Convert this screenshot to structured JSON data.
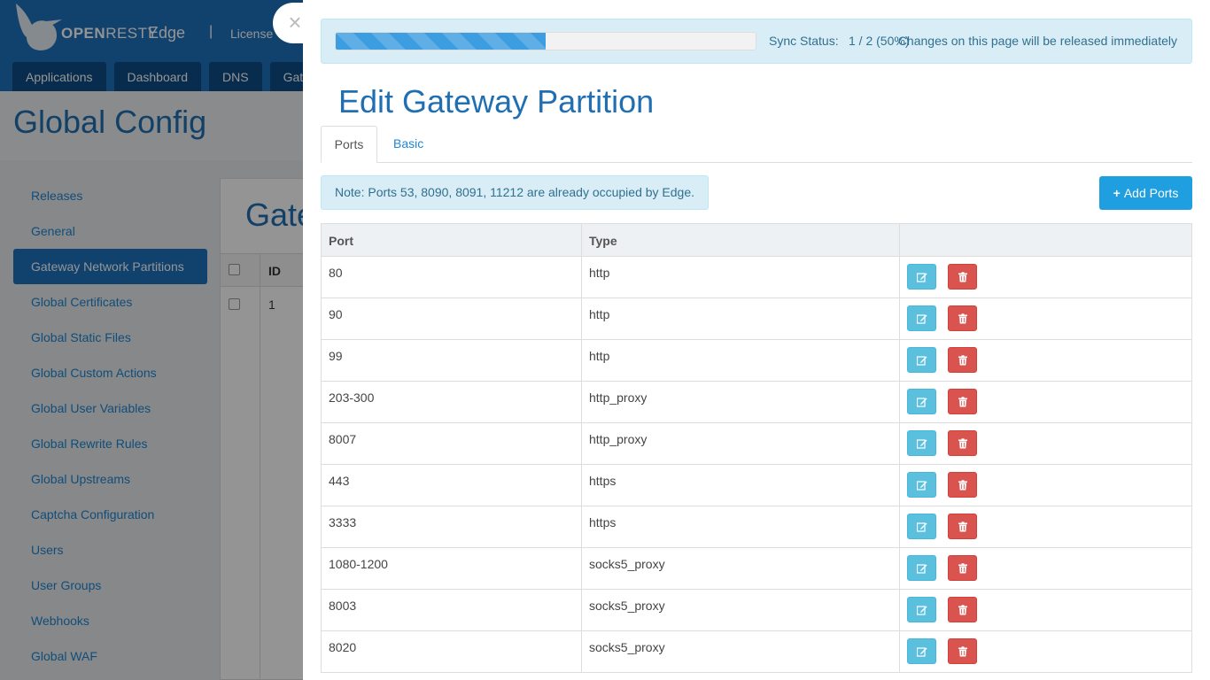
{
  "app": {
    "brand_open": "OPEN",
    "brand_resty": "RESTY",
    "product": "Edge",
    "separator": "|",
    "license_label": "License"
  },
  "nav_tabs": [
    "Applications",
    "Dashboard",
    "DNS",
    "Gat"
  ],
  "page_title": "Global Config",
  "sidebar": {
    "items": [
      {
        "label": "Releases",
        "active": false
      },
      {
        "label": "General",
        "active": false
      },
      {
        "label": "Gateway Network Partitions",
        "active": true
      },
      {
        "label": "Global Certificates",
        "active": false
      },
      {
        "label": "Global Static Files",
        "active": false
      },
      {
        "label": "Global Custom Actions",
        "active": false
      },
      {
        "label": "Global User Variables",
        "active": false
      },
      {
        "label": "Global Rewrite Rules",
        "active": false
      },
      {
        "label": "Global Upstreams",
        "active": false
      },
      {
        "label": "Captcha Configuration",
        "active": false
      },
      {
        "label": "Users",
        "active": false
      },
      {
        "label": "User Groups",
        "active": false
      },
      {
        "label": "Webhooks",
        "active": false
      },
      {
        "label": "Global WAF",
        "active": false
      }
    ]
  },
  "background_panel": {
    "title": "Gate",
    "id_header": "ID",
    "first_id": "1"
  },
  "drawer": {
    "close_glyph": "×",
    "sync": {
      "label": "Sync Status:",
      "value": "1 / 2 (50%)",
      "progress": 0.5,
      "note": "Changes on this page will be released immediately"
    },
    "title": "Edit Gateway Partition",
    "tabs": [
      {
        "label": "Ports",
        "active": true
      },
      {
        "label": "Basic",
        "active": false
      }
    ],
    "note": "Note: Ports 53, 8090, 8091, 11212 are already occupied by Edge.",
    "add_button": "Add Ports",
    "add_icon": "+",
    "table": {
      "columns": [
        "Port",
        "Type",
        ""
      ],
      "rows": [
        {
          "port": "80",
          "type": "http"
        },
        {
          "port": "90",
          "type": "http"
        },
        {
          "port": "99",
          "type": "http"
        },
        {
          "port": "203-300",
          "type": "http_proxy"
        },
        {
          "port": "8007",
          "type": "http_proxy"
        },
        {
          "port": "443",
          "type": "https"
        },
        {
          "port": "3333",
          "type": "https"
        },
        {
          "port": "1080-1200",
          "type": "socks5_proxy"
        },
        {
          "port": "8003",
          "type": "socks5_proxy"
        },
        {
          "port": "8020",
          "type": "socks5_proxy"
        }
      ]
    }
  },
  "colors": {
    "brand_blue": "#1e73be",
    "info_bg": "#d9edf7",
    "edit_button": "#5bc0de",
    "delete_button": "#d9534f"
  }
}
